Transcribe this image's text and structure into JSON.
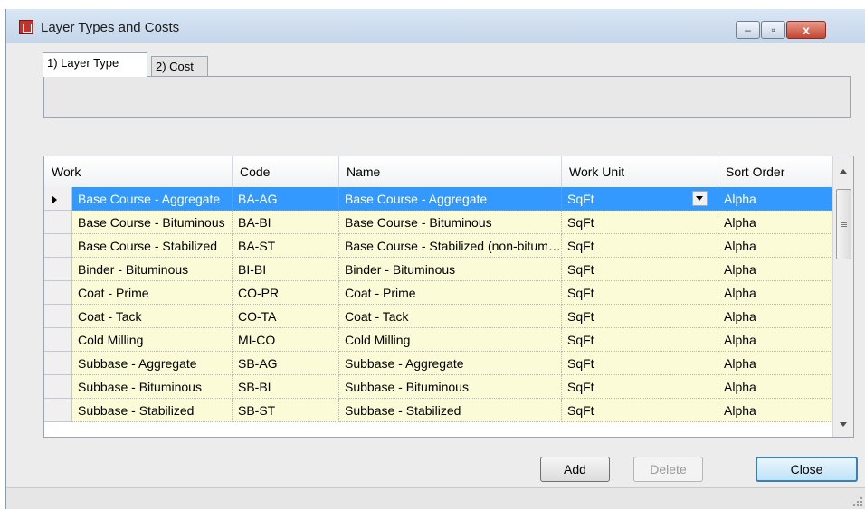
{
  "window": {
    "title": "Layer Types and Costs",
    "controls": {
      "minimize": "–",
      "maximize": "▫",
      "close": "x"
    }
  },
  "tabs": [
    {
      "label": "1) Layer Type",
      "active": true
    },
    {
      "label": "2) Cost",
      "active": false
    }
  ],
  "grid": {
    "columns": [
      "Work",
      "Code",
      "Name",
      "Work Unit",
      "Sort Order"
    ],
    "rows": [
      {
        "work": "Base Course - Aggregate",
        "code": "BA-AG",
        "name": "Base Course - Aggregate",
        "unit": "SqFt",
        "sort": "Alpha"
      },
      {
        "work": "Base Course - Bituminous",
        "code": "BA-BI",
        "name": "Base Course - Bituminous",
        "unit": "SqFt",
        "sort": "Alpha"
      },
      {
        "work": "Base Course - Stabilized",
        "code": "BA-ST",
        "name": "Base Course - Stabilized (non-bituminous)",
        "unit": "SqFt",
        "sort": "Alpha"
      },
      {
        "work": "Binder - Bituminous",
        "code": "BI-BI",
        "name": "Binder - Bituminous",
        "unit": "SqFt",
        "sort": "Alpha"
      },
      {
        "work": "Coat - Prime",
        "code": "CO-PR",
        "name": "Coat - Prime",
        "unit": "SqFt",
        "sort": "Alpha"
      },
      {
        "work": "Coat - Tack",
        "code": "CO-TA",
        "name": "Coat - Tack",
        "unit": "SqFt",
        "sort": "Alpha"
      },
      {
        "work": "Cold Milling",
        "code": "MI-CO",
        "name": "Cold Milling",
        "unit": "SqFt",
        "sort": "Alpha"
      },
      {
        "work": "Subbase - Aggregate",
        "code": "SB-AG",
        "name": "Subbase - Aggregate",
        "unit": "SqFt",
        "sort": "Alpha"
      },
      {
        "work": "Subbase - Bituminous",
        "code": "SB-BI",
        "name": "Subbase - Bituminous",
        "unit": "SqFt",
        "sort": "Alpha"
      },
      {
        "work": "Subbase - Stabilized",
        "code": "SB-ST",
        "name": "Subbase - Stabilized",
        "unit": "SqFt",
        "sort": "Alpha"
      }
    ],
    "selected_row": 0
  },
  "buttons": {
    "add": "Add",
    "delete": "Delete",
    "close": "Close"
  },
  "colors": {
    "selection": "#3399ff",
    "row_background": "#fbfbd8",
    "window_background": "#ececec"
  }
}
